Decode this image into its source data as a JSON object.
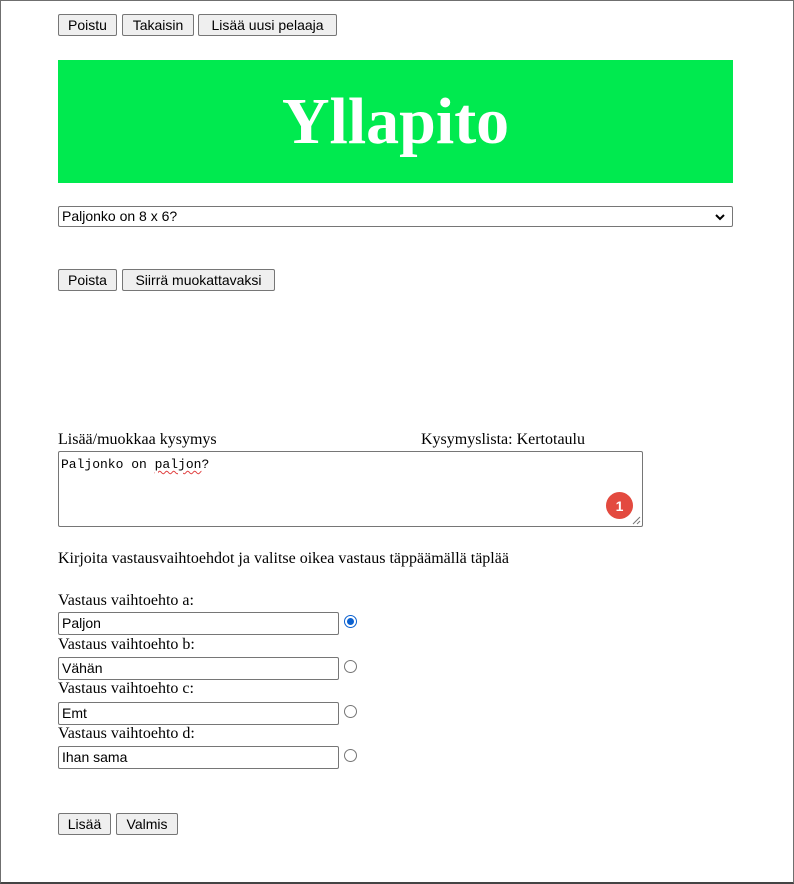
{
  "toolbar": {
    "exit_label": "Poistu",
    "back_label": "Takaisin",
    "add_player_label": "Lisää uusi pelaaja"
  },
  "header": {
    "title": "Yllapito",
    "background_color": "#00ea4f"
  },
  "question_select": {
    "selected_value": "Paljonko on 8 x 6?"
  },
  "question_actions": {
    "delete_label": "Poista",
    "move_to_edit_label": "Siirrä muokattavaksi"
  },
  "editor": {
    "add_edit_label": "Lisää/muokkaa kysymys",
    "question_list_label": "Kysymyslista: Kertotaulu",
    "question_text_before": "Paljonko on ",
    "question_text_misspelled": "paljon",
    "question_text_after": "?",
    "notification_count": "1"
  },
  "instructions": "Kirjoita vastausvaihtoehdot ja valitse oikea vastaus täppäämällä täplää",
  "answers": [
    {
      "label": "Vastaus vaihtoehto a:",
      "value": "Paljon",
      "correct": true
    },
    {
      "label": "Vastaus vaihtoehto b:",
      "value": "Vähän",
      "correct": false
    },
    {
      "label": "Vastaus vaihtoehto c:",
      "value": "Emt",
      "correct": false
    },
    {
      "label": "Vastaus vaihtoehto d:",
      "value": "Ihan sama",
      "correct": false
    }
  ],
  "footer_actions": {
    "add_label": "Lisää",
    "done_label": "Valmis"
  },
  "colors": {
    "radio_accent": "#0b61d0",
    "badge": "#e34a3f"
  }
}
